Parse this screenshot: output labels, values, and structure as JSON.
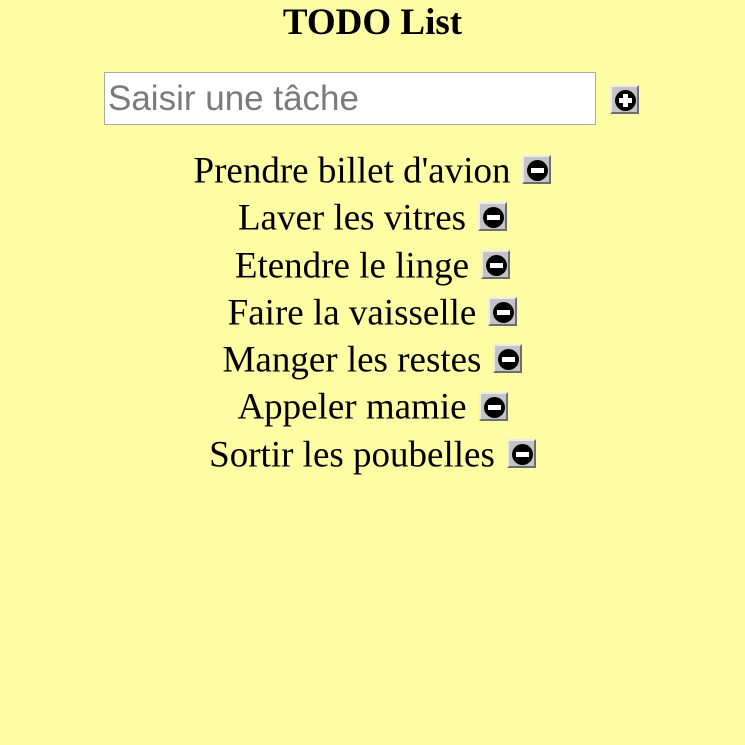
{
  "header": {
    "title": "TODO List"
  },
  "new_task": {
    "placeholder": "Saisir une tâche",
    "value": "",
    "add_icon": "plus-circle-icon"
  },
  "tasks": [
    {
      "label": "Prendre billet d'avion",
      "remove_icon": "minus-circle-icon"
    },
    {
      "label": "Laver les vitres",
      "remove_icon": "minus-circle-icon"
    },
    {
      "label": "Etendre le linge",
      "remove_icon": "minus-circle-icon"
    },
    {
      "label": "Faire la vaisselle",
      "remove_icon": "minus-circle-icon"
    },
    {
      "label": "Manger les restes",
      "remove_icon": "minus-circle-icon"
    },
    {
      "label": "Appeler mamie",
      "remove_icon": "minus-circle-icon"
    },
    {
      "label": "Sortir les poubelles",
      "remove_icon": "minus-circle-icon"
    }
  ],
  "colors": {
    "background": "#fffda4",
    "text": "#000000",
    "button_face": "#c4c4c4"
  }
}
